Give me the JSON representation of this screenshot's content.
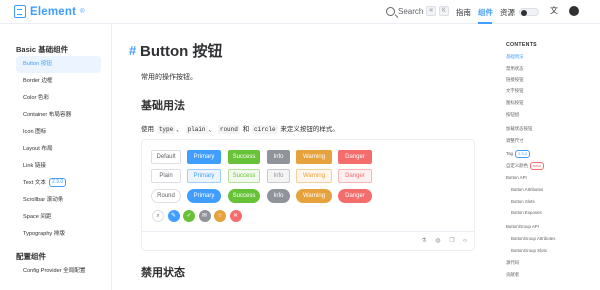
{
  "header": {
    "logo_text": "Element",
    "logo_reg": "®",
    "search_label": "Search",
    "kbd_1": "⌘",
    "kbd_2": "K",
    "nav": [
      "指南",
      "组件",
      "资源"
    ],
    "active_nav": "组件"
  },
  "sidebar": {
    "groups": [
      {
        "title": "Basic 基础组件",
        "items": [
          {
            "label": "Button 按钮",
            "active": true
          },
          {
            "label": "Border 边框"
          },
          {
            "label": "Color 色彩"
          },
          {
            "label": "Container 布局容器"
          },
          {
            "label": "Icon 图标"
          },
          {
            "label": "Layout 布局"
          },
          {
            "label": "Link 链接"
          },
          {
            "label": "Text 文本",
            "badge": "2.3.0"
          },
          {
            "label": "Scrollbar 滚动条"
          },
          {
            "label": "Space 间距"
          },
          {
            "label": "Typography 排版"
          }
        ]
      },
      {
        "title": "配置组件",
        "items": [
          {
            "label": "Config Provider 全局配置"
          }
        ]
      }
    ]
  },
  "main": {
    "hash": "#",
    "title": "Button 按钮",
    "intro": "常用的操作按钮。",
    "section_title": "基础用法",
    "desc": {
      "prefix": "使用",
      "code1": "type",
      "sep1": "、",
      "code2": "plain",
      "sep2": "、",
      "code3": "round",
      "and": "和",
      "code4": "circle",
      "suffix": "来定义按钮的样式。"
    },
    "next_section_title": "禁用状态",
    "button_rows": [
      [
        "Default",
        "Primary",
        "Success",
        "Info",
        "Warning",
        "Danger"
      ],
      [
        "Plain",
        "Primary",
        "Success",
        "Info",
        "Warning",
        "Danger"
      ],
      [
        "Round",
        "Primary",
        "Success",
        "Info",
        "Warning",
        "Danger"
      ]
    ],
    "circle_icons": [
      "search-icon",
      "edit-icon",
      "check-icon",
      "message-icon",
      "star-icon",
      "delete-icon"
    ],
    "footer_icons": [
      "playground-icon",
      "github-icon",
      "copy-icon",
      "code-icon"
    ]
  },
  "colors": {
    "primary": "#409eff",
    "success": "#67c23a",
    "info": "#909399",
    "warning": "#e6a23c",
    "danger": "#f56c6c"
  },
  "toc": {
    "title": "CONTENTS",
    "items": [
      {
        "label": "基础用法",
        "active": true
      },
      {
        "label": "禁用状态"
      },
      {
        "label": "链接按钮"
      },
      {
        "label": "文字按钮"
      },
      {
        "label": "图标按钮"
      },
      {
        "label": "按钮组"
      },
      {
        "label": "加载状态按钮"
      },
      {
        "label": "调整尺寸"
      },
      {
        "label": "Tag",
        "badge": "2.3.4"
      },
      {
        "label": "自定义颜色",
        "badge": "beta"
      },
      {
        "label": "Button API"
      },
      {
        "label": "Button Attributes",
        "indent": true
      },
      {
        "label": "Button Slots",
        "indent": true
      },
      {
        "label": "Button Exposes",
        "indent": true
      },
      {
        "label": "ButtonGroup API"
      },
      {
        "label": "ButtonGroup Attributes",
        "indent": true
      },
      {
        "label": "ButtonGroup Slots",
        "indent": true
      },
      {
        "label": "源代码"
      },
      {
        "label": "贡献者"
      }
    ]
  }
}
